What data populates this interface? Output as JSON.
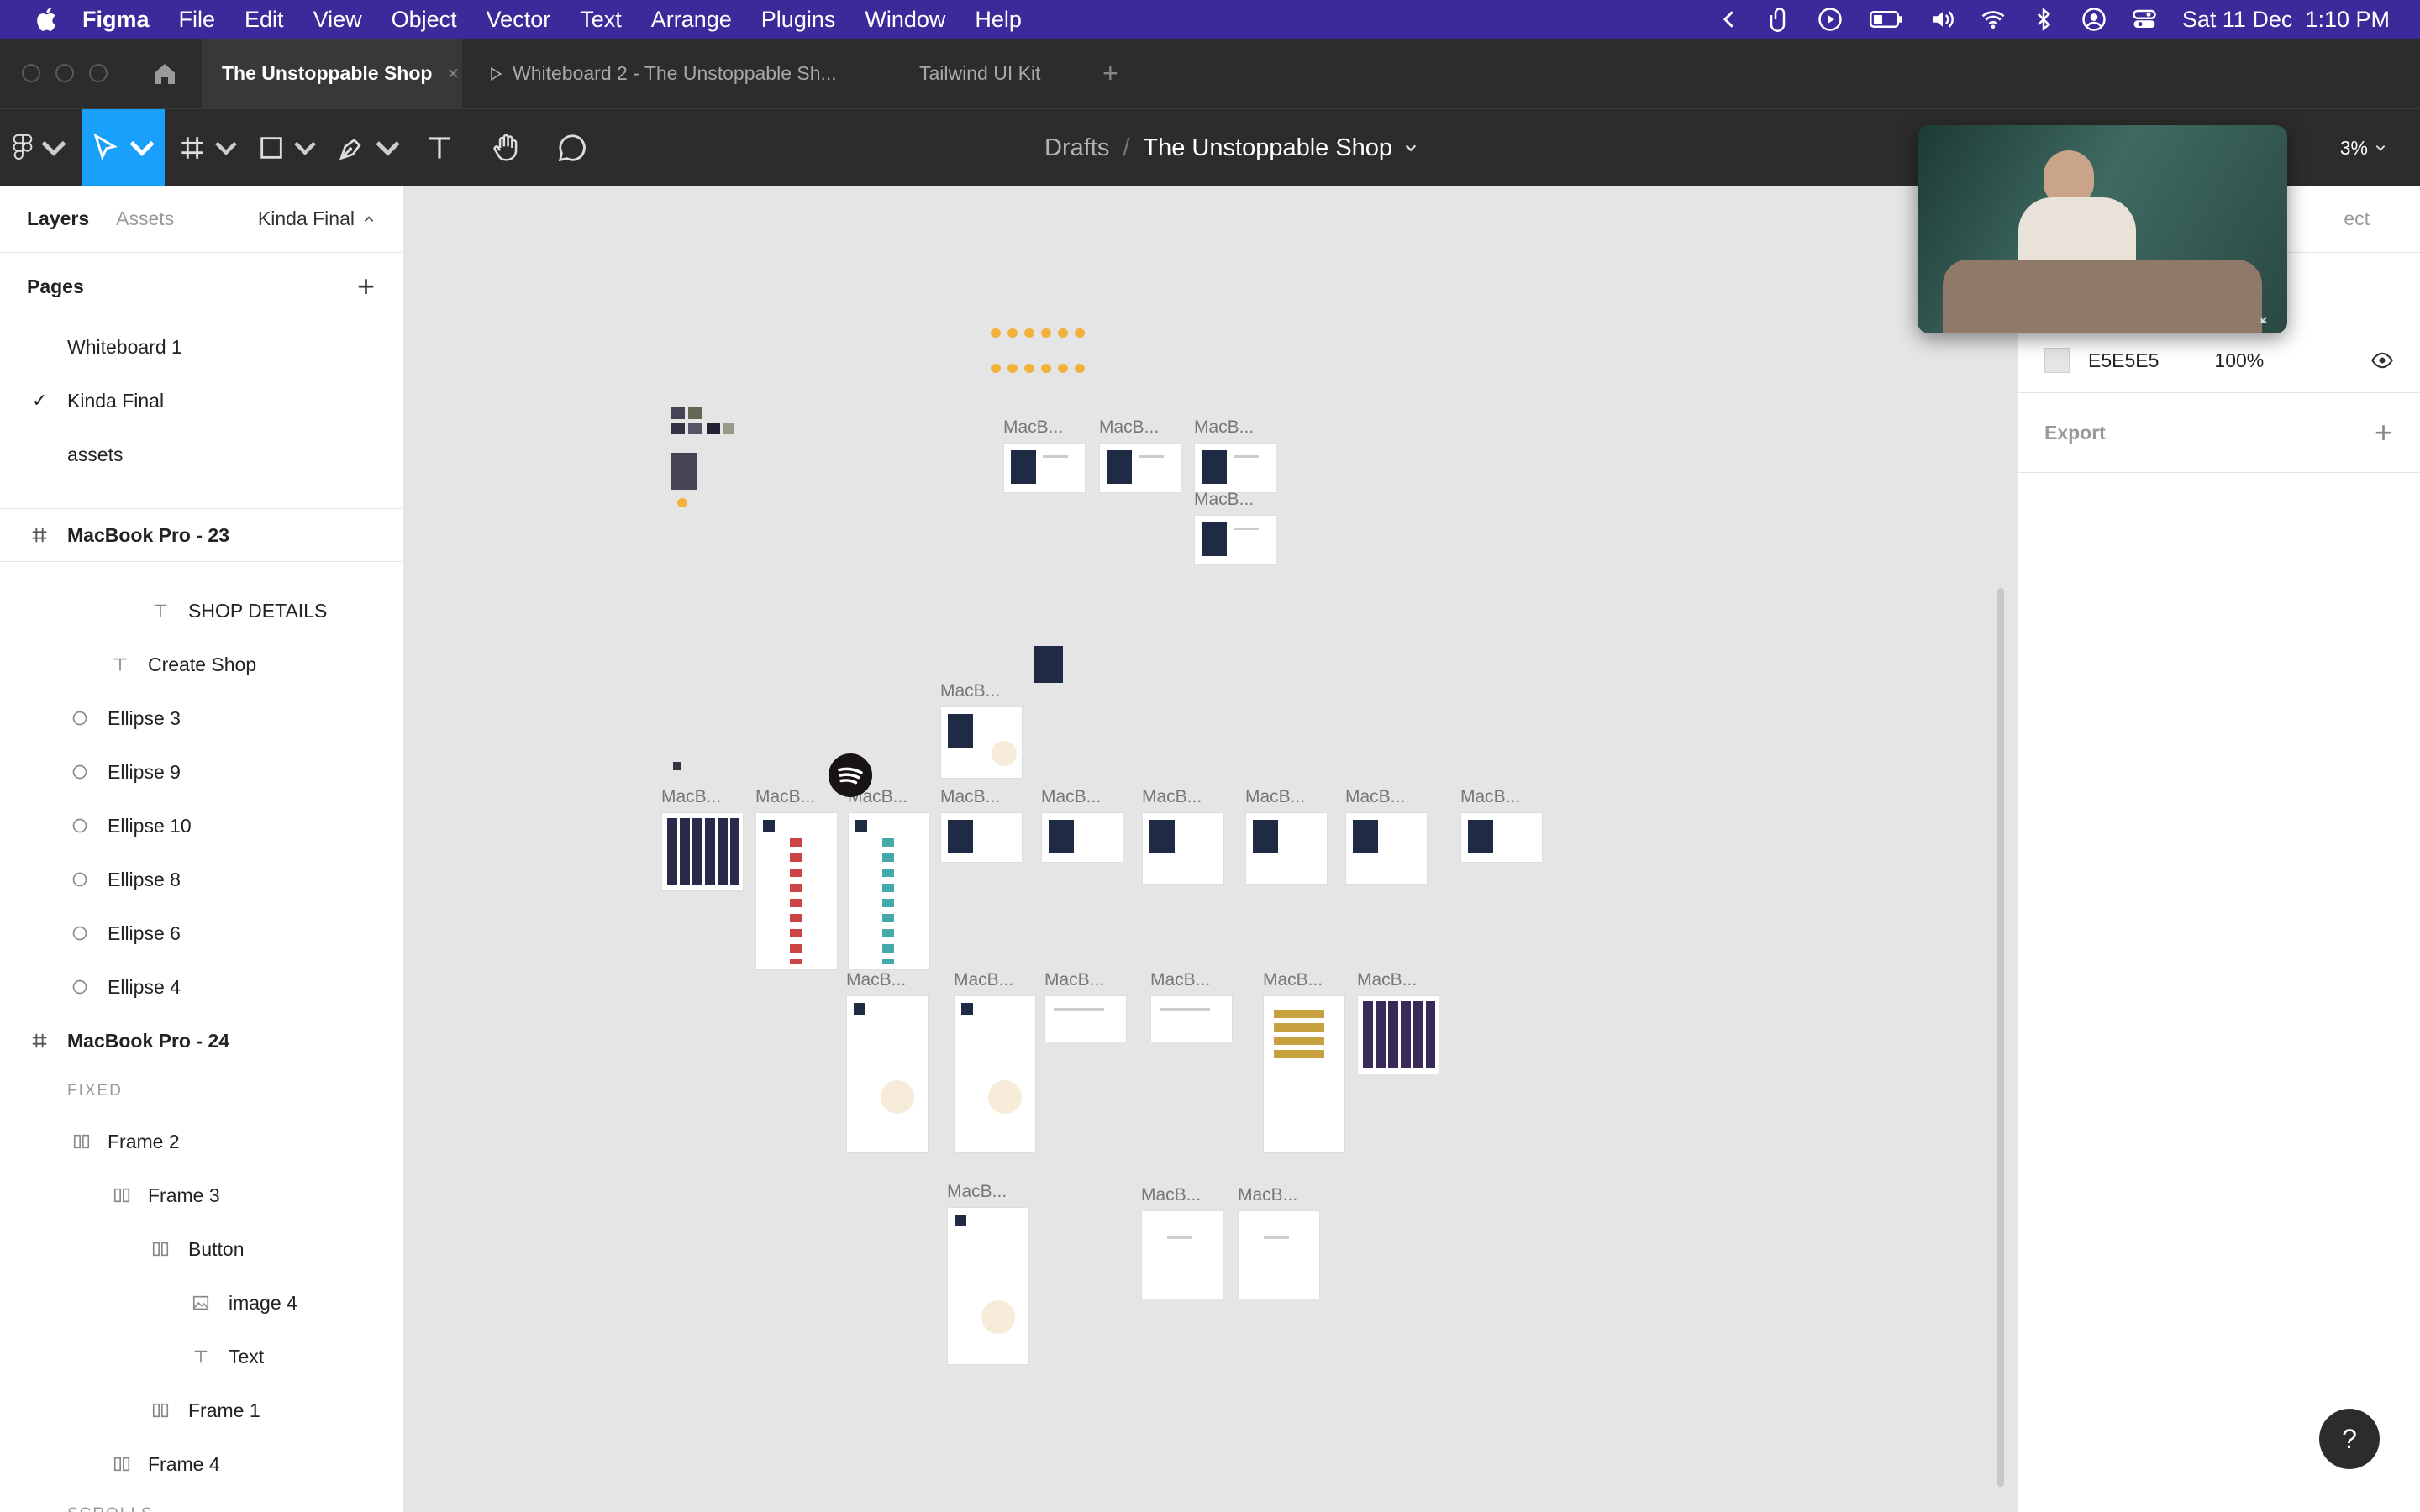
{
  "menubar": {
    "app": "Figma",
    "items": [
      "File",
      "Edit",
      "View",
      "Object",
      "Vector",
      "Text",
      "Arrange",
      "Plugins",
      "Window",
      "Help"
    ],
    "datetime": "Sat 11 Dec  1:10 PM"
  },
  "tabs": [
    {
      "label": "The Unstoppable Shop",
      "active": true
    },
    {
      "label": "Whiteboard 2 - The Unstoppable Sh...",
      "active": false
    },
    {
      "label": "Tailwind UI Kit",
      "active": false
    }
  ],
  "toolbar": {
    "breadcrumb_parent": "Drafts",
    "breadcrumb_sep": "/",
    "file_name": "The Unstoppable Shop",
    "zoom": "3%"
  },
  "left_panel": {
    "tab_layers": "Layers",
    "tab_assets": "Assets",
    "current_page": "Kinda Final",
    "pages_title": "Pages",
    "pages": [
      {
        "label": "Whiteboard 1",
        "selected": false
      },
      {
        "label": "Kinda Final",
        "selected": true
      },
      {
        "label": "assets",
        "selected": false
      }
    ],
    "frame1": "MacBook Pro - 23",
    "frame1_children": [
      "SHOP DETAILS",
      "Create Shop",
      "Ellipse 3",
      "Ellipse 9",
      "Ellipse 10",
      "Ellipse 8",
      "Ellipse 6",
      "Ellipse 4"
    ],
    "frame2": "MacBook Pro - 24",
    "fixed_label": "FIXED",
    "frame2_children": [
      "Frame 2",
      "Frame 3",
      "Button",
      "image 4",
      "Text",
      "Frame 1",
      "Frame 4"
    ],
    "scrolls_label": "SCROLLS"
  },
  "canvas": {
    "frame_label": "MacB..."
  },
  "right_panel": {
    "hidden_tab": "ect",
    "fill_hex": "E5E5E5",
    "fill_opacity": "100%",
    "export_label": "Export"
  },
  "help_label": "?",
  "colors": {
    "menubar": "#3a2a9a",
    "chrome": "#2c2c2c",
    "accent": "#18a0fb",
    "canvas": "#e5e5e5"
  }
}
